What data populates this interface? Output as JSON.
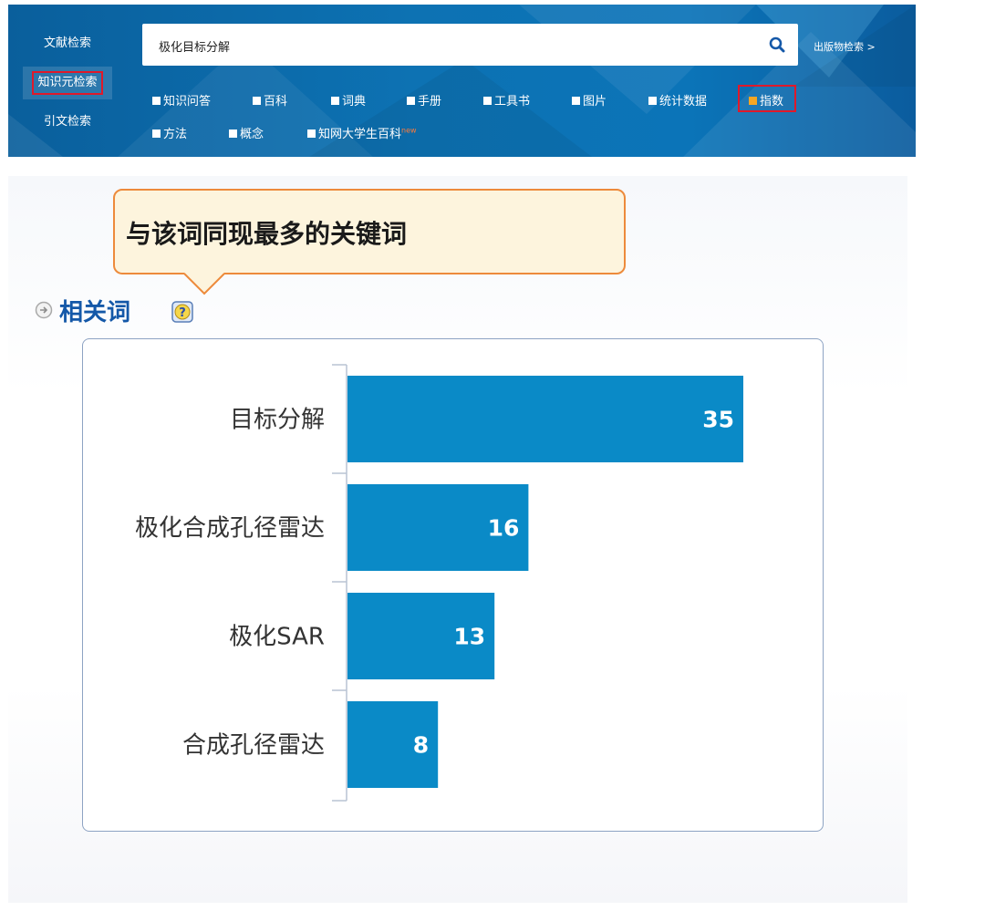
{
  "header": {
    "side_tabs": [
      "文献检索",
      "知识元检索",
      "引文检索"
    ],
    "search_value": "极化目标分解",
    "publication_link": "出版物检索  >",
    "options_row1": [
      "知识问答",
      "百科",
      "词典",
      "手册",
      "工具书",
      "图片",
      "统计数据",
      "指数"
    ],
    "options_row2": [
      "方法",
      "概念",
      "知网大学生百科"
    ],
    "new_badge": "new",
    "checked_option": "指数",
    "accent_color": "#0b6fb0",
    "highlight_color": "#e0192a"
  },
  "callout": {
    "text": "与该词同现最多的关键词",
    "border_color": "#ed8a3b",
    "fill_color": "#fdf4dd"
  },
  "section": {
    "label": "相关词",
    "icons": [
      "arrow-circle-icon",
      "help-icon"
    ]
  },
  "chart_data": {
    "type": "bar",
    "orientation": "horizontal",
    "categories": [
      "目标分解",
      "极化合成孔径雷达",
      "极化SAR",
      "合成孔径雷达"
    ],
    "values": [
      35,
      16,
      13,
      8
    ],
    "bar_color": "#0a8ac7",
    "data_labels": true,
    "grid": false
  }
}
